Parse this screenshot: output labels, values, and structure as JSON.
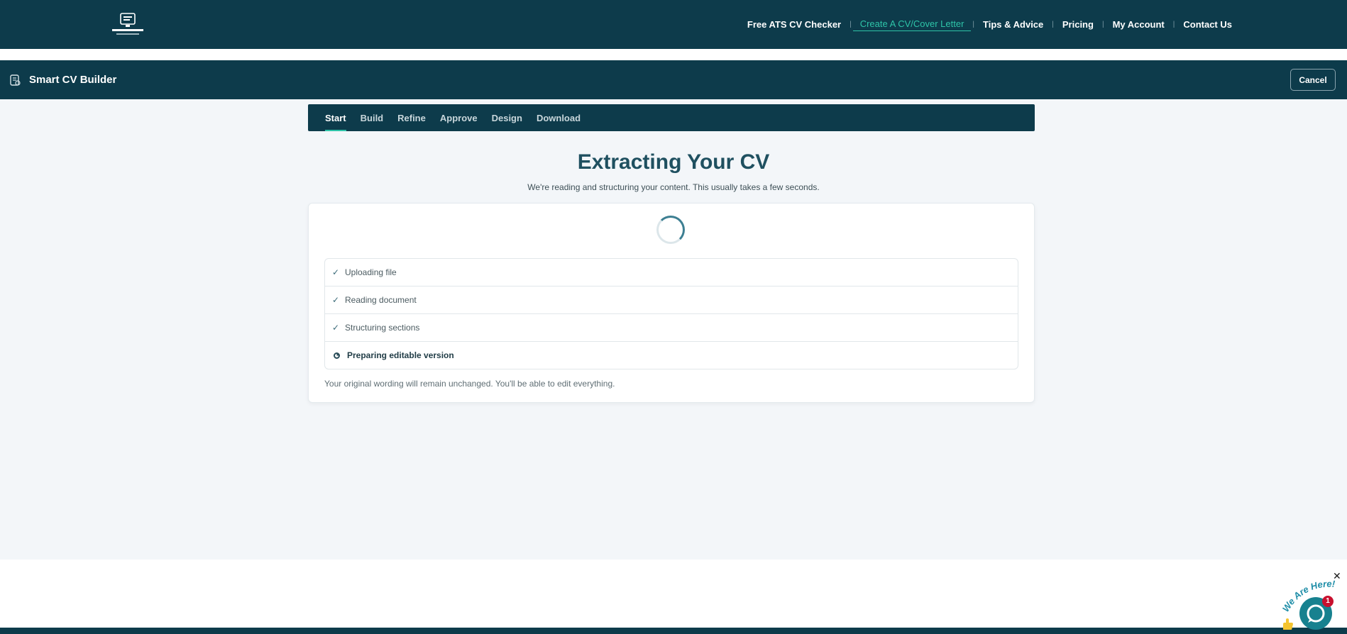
{
  "nav": {
    "links": [
      {
        "label": "Free ATS CV Checker",
        "active": false
      },
      {
        "label": "Create A CV/Cover Letter",
        "active": true
      },
      {
        "label": "Tips & Advice",
        "active": false
      },
      {
        "label": "Pricing",
        "active": false
      },
      {
        "label": "My Account",
        "active": false
      },
      {
        "label": "Contact Us",
        "active": false
      }
    ]
  },
  "builder": {
    "title": "Smart CV Builder",
    "cancel_label": "Cancel"
  },
  "steps": {
    "tabs": [
      "Start",
      "Build",
      "Refine",
      "Approve",
      "Design",
      "Download"
    ],
    "active_index": 0
  },
  "main": {
    "heading": "Extracting Your CV",
    "subheading": "We're reading and structuring your content. This usually takes a few seconds.",
    "progress_items": [
      {
        "label": "Uploading file",
        "status": "done"
      },
      {
        "label": "Reading document",
        "status": "done"
      },
      {
        "label": "Structuring sections",
        "status": "done"
      },
      {
        "label": "Preparing editable version",
        "status": "in-progress"
      }
    ],
    "note": "Your original wording will remain unchanged. You'll be able to edit everything."
  },
  "chat": {
    "badge_count": "1",
    "teaser": "We Are Here!"
  },
  "colors": {
    "brand_dark": "#0d3b4b",
    "accent": "#2ec4a8",
    "chat": "#17818f"
  }
}
